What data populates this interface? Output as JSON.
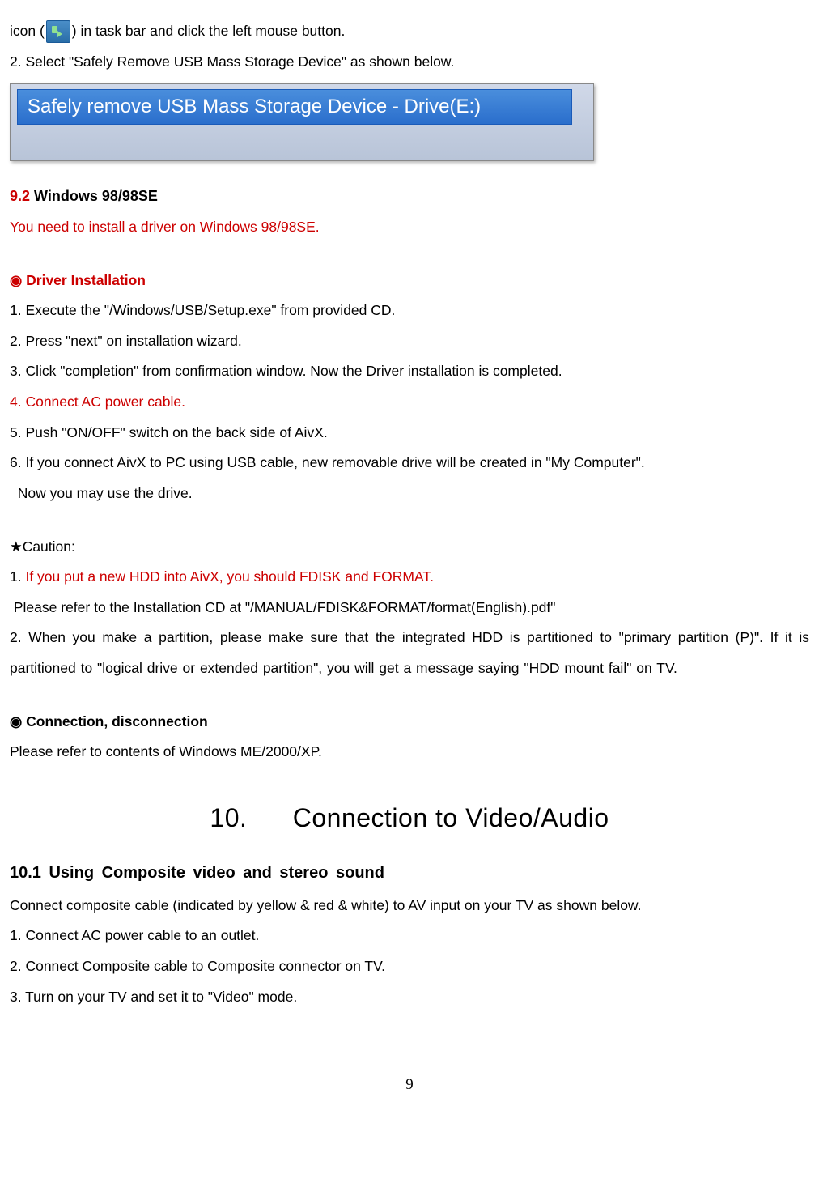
{
  "intro": {
    "line1_pre": "icon (",
    "line1_post": ") in task bar and click the left mouse button.",
    "step2": "2. Select \"Safely Remove USB Mass Storage Device\" as shown below."
  },
  "screenshot": {
    "menu_text": "Safely remove USB Mass Storage Device - Drive(E:)"
  },
  "section92": {
    "num": "9.2",
    "title": " Windows  98/98SE",
    "note": "You need to install a driver on Windows 98/98SE."
  },
  "driver": {
    "heading": "◉ Driver Installation",
    "s1": "1.    Execute the \"/Windows/USB/Setup.exe\" from provided CD.",
    "s2": "2. Press \"next\" on installation wizard.",
    "s3": "3. Click \"completion\" from confirmation window. Now the Driver installation is completed.",
    "s4": "4. Connect   AC power cable.",
    "s5": "5. Push \"ON/OFF\" switch on the back side of AivX.",
    "s6a": "6. If you connect AivX to PC using USB cable, new removable drive will be created in \"My Computer\".",
    "s6b": "  Now you may use the drive."
  },
  "caution": {
    "heading": "★Caution:",
    "c1_pre": "1. ",
    "c1_red": "If you put a new HDD into AivX, you should FDISK and FORMAT.",
    "c1_ref": " Please refer to the Installation CD at \"/MANUAL/FDISK&FORMAT/format(English).pdf\"",
    "c2": "2. When you make a partition, please make sure that the integrated HDD is partitioned to \"primary partition (P)\". If it is partitioned to \"logical drive or extended partition\", you will get a message saying \"HDD mount fail\" on TV."
  },
  "conn": {
    "heading": "◉ Connection, disconnection",
    "text": "Please refer to contents of Windows ME/2000/XP."
  },
  "section10": {
    "heading": "10.      Connection to Video/Audio",
    "sub": "10.1 Using Composite video and stereo sound",
    "intro": "Connect composite cable (indicated by yellow & red & white) to AV input on your TV as shown below.",
    "s1": "1. Connect AC power cable to an outlet.",
    "s2": "2. Connect Composite cable to Composite connector on TV.",
    "s3": "3. Turn on your TV and set it to \"Video\" mode."
  },
  "page_num": "9"
}
